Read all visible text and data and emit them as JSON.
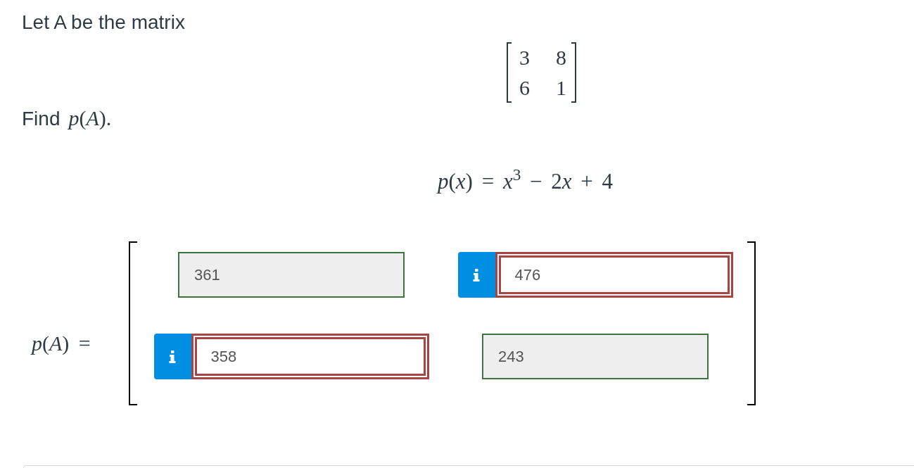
{
  "question": {
    "intro": "Let A be the matrix",
    "matrix": [
      [
        "3",
        "8"
      ],
      [
        "6",
        "1"
      ]
    ],
    "prompt": "Find",
    "prompt_math": "*p*(*A*).",
    "polynomial": [
      "*p*(*x*) = *x*$^{3}$ − 2",
      "*x* + 4"
    ]
  },
  "answer": {
    "label": "*p*(*A*) =",
    "cells": [
      {
        "value": "361",
        "correct": true
      },
      {
        "value": "476",
        "correct": false
      },
      {
        "value": "358",
        "correct": false
      },
      {
        "value": "243",
        "correct": true
      }
    ]
  }
}
